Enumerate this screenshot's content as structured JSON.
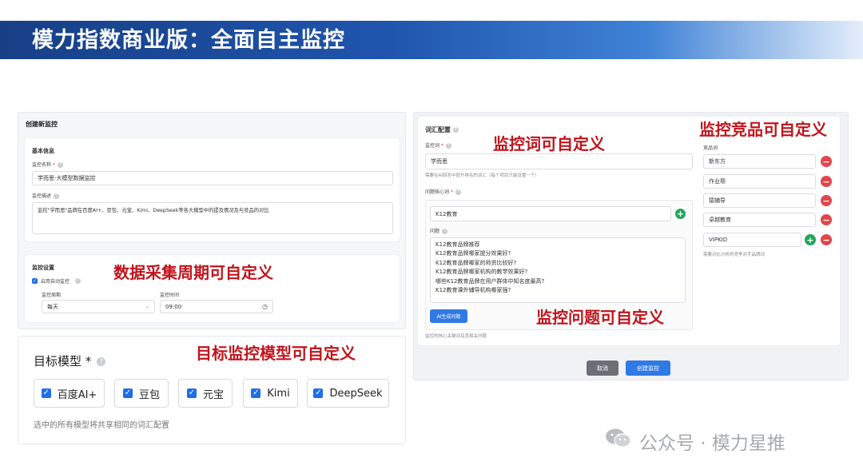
{
  "header": {
    "title": "模力指数商业版：全面自主监控"
  },
  "left": {
    "page_title": "创建新监控",
    "basic": {
      "section_title": "基本信息",
      "name_label": "监控名称",
      "name_value": "学而思-大模型数据监控",
      "desc_label": "监控描述",
      "desc_value": "监控\"学而思\"品牌在百度AI+、豆包、元宝、Kimi、DeepSeek等各大模型中的提及情况及与竞品的对比"
    },
    "settings": {
      "section_title": "监控设置",
      "auto_label": "启用自动监控",
      "cycle_label": "监控周期",
      "cycle_value": "每天",
      "time_label": "监控时间",
      "time_value": "09:00"
    },
    "models": {
      "title": "目标模型",
      "required_mark": "*",
      "items": [
        "百度AI+",
        "豆包",
        "元宝",
        "Kimi",
        "DeepSeek"
      ],
      "note": "选中的所有模型将共享相同的词汇配置"
    }
  },
  "right": {
    "section_title": "词汇配置",
    "monitor_word_label": "监控词",
    "monitor_word_value": "学而思",
    "monitor_word_hint": "需要在AI回答中提升排名的词汇（每个项目只能设置一个）",
    "core_label": "问题核心词",
    "core_value": "K12教育",
    "question_label": "问题",
    "questions": [
      "K12教育品牌推荐",
      "K12教育品牌哪家提分效果好?",
      "K12教育品牌哪家的师资比较好?",
      "K12教育品牌哪家机构的教学效果好?",
      "哪些K12教育品牌在用户群体中知名度最高?",
      "K12教育课外辅导机构哪家强?"
    ],
    "ai_button": "AI生成问题",
    "core_hint": "监控的核心关键词及其相关问题",
    "competitor_label": "竞品词",
    "competitors": [
      "新东方",
      "作业帮",
      "猿辅导",
      "卓越教育",
      "VIPKID"
    ],
    "competitor_hint": "需要对比分析的竞争对手品牌词",
    "cancel_button": "取消",
    "create_button": "创建监控"
  },
  "annotations": {
    "cycle": "数据采集周期可自定义",
    "models": "目标监控模型可自定义",
    "words": "监控词可自定义",
    "competitors": "监控竞品可自定义",
    "questions": "监控问题可自定义"
  },
  "watermark": {
    "text": "公众号 · 模力星推",
    "icon": "wechat-icon"
  },
  "colors": {
    "accent": "#2f7ae5",
    "annotation": "#c0141c",
    "banner": "#1f55ad",
    "add": "#22a55a",
    "remove": "#e0464b"
  }
}
